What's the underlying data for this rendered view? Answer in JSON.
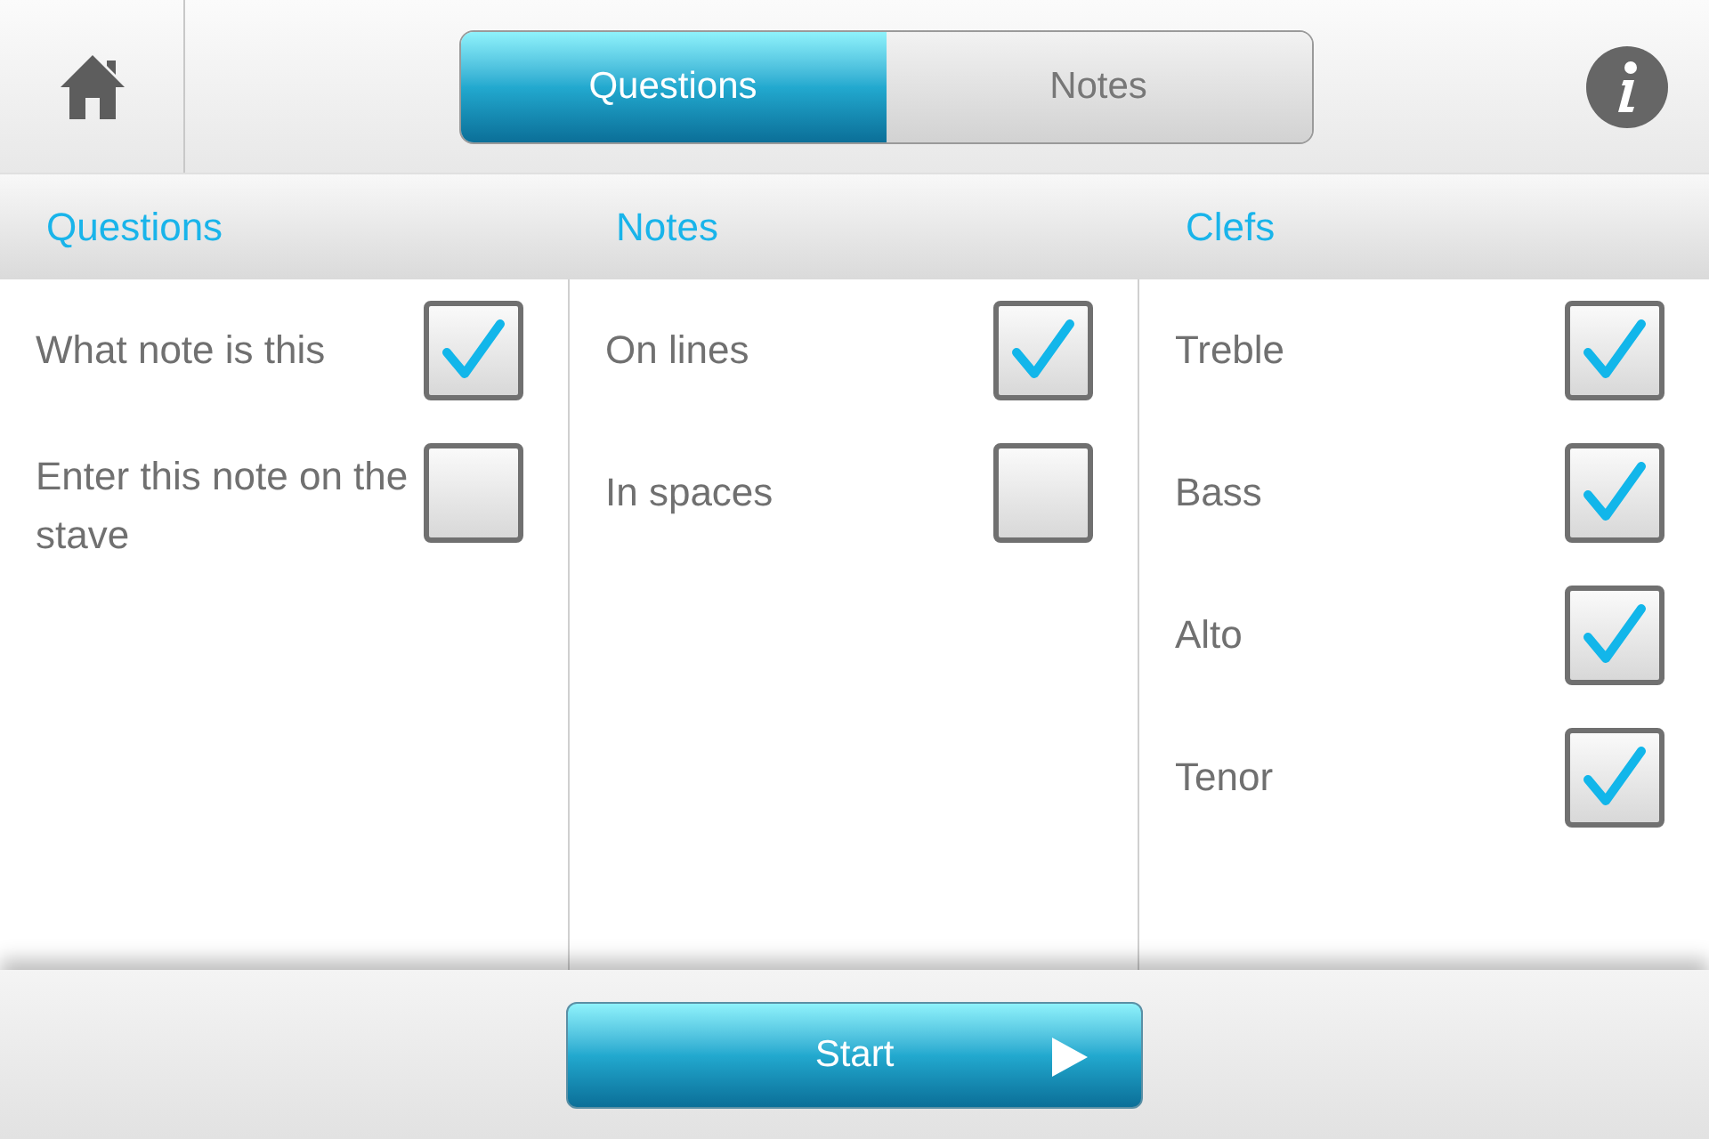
{
  "tabs": [
    {
      "label": "Questions",
      "selected": true
    },
    {
      "label": "Notes",
      "selected": false
    }
  ],
  "columns": [
    {
      "heading": "Questions",
      "options": [
        {
          "label": "What note is this",
          "checked": true
        },
        {
          "label": "Enter this note on the stave",
          "checked": false
        }
      ]
    },
    {
      "heading": "Notes",
      "options": [
        {
          "label": "On lines",
          "checked": true
        },
        {
          "label": "In spaces",
          "checked": false
        }
      ]
    },
    {
      "heading": "Clefs",
      "options": [
        {
          "label": "Treble",
          "checked": true
        },
        {
          "label": "Bass",
          "checked": true
        },
        {
          "label": "Alto",
          "checked": true
        },
        {
          "label": "Tenor",
          "checked": true
        }
      ]
    }
  ],
  "start_button": {
    "label": "Start"
  }
}
